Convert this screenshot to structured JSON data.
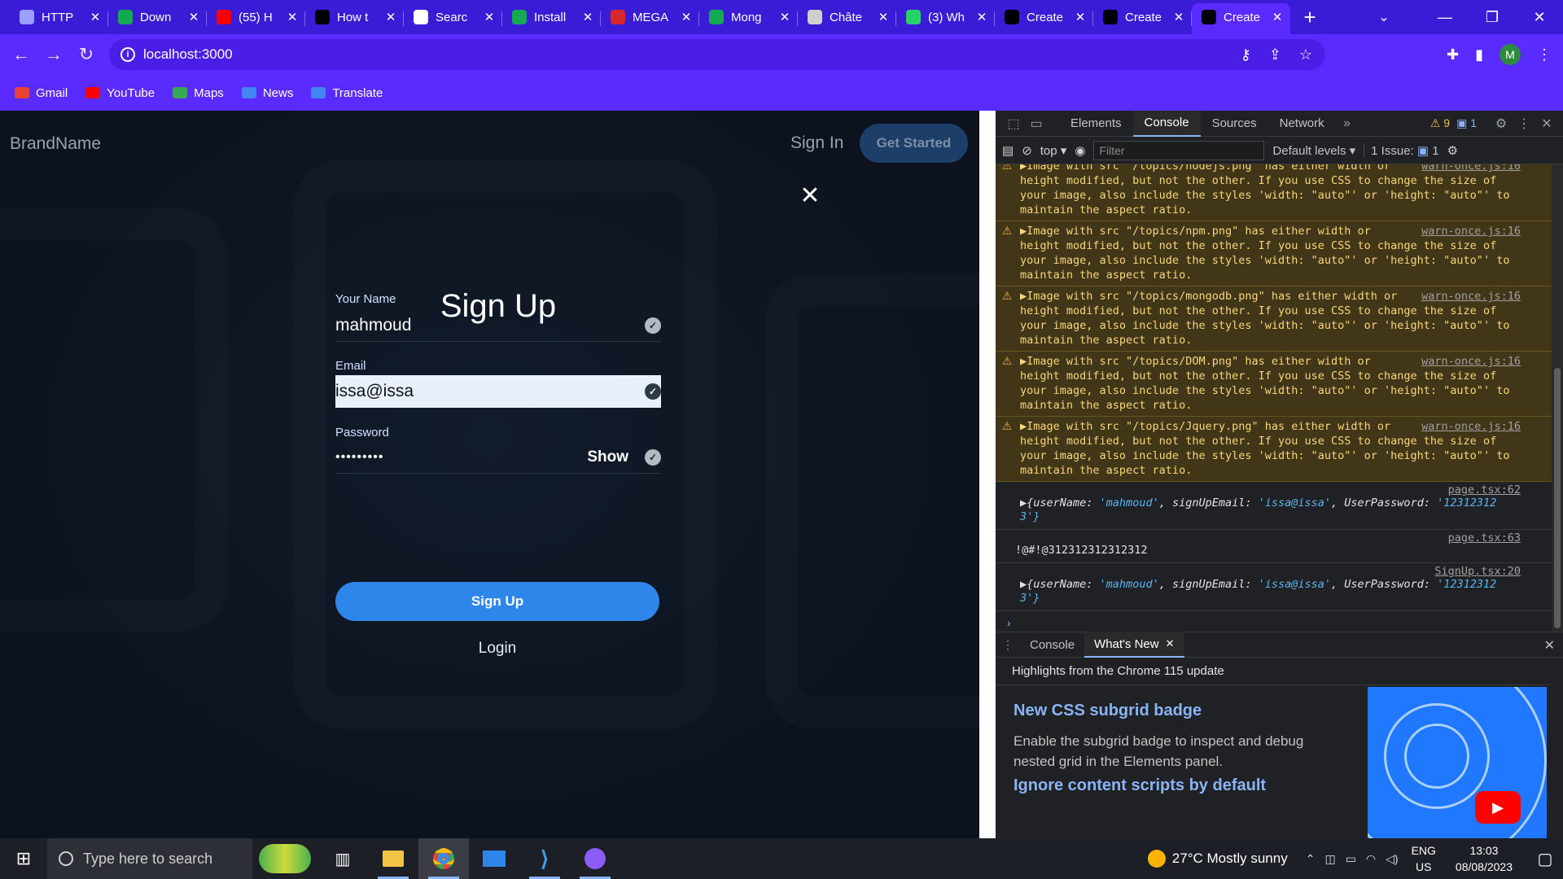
{
  "browser": {
    "tabs": [
      {
        "title": "HTTP",
        "icon": "globe-icon",
        "color": "#9aa0ff"
      },
      {
        "title": "Down",
        "icon": "mongodb-leaf-icon",
        "color": "#13aa52"
      },
      {
        "title": "(55) H",
        "icon": "youtube-icon",
        "color": "#ff0000"
      },
      {
        "title": "How t",
        "icon": "medium-icon",
        "color": "#000000"
      },
      {
        "title": "Searc",
        "icon": "search-doc-icon",
        "color": "#ffffff"
      },
      {
        "title": "Install",
        "icon": "mongodb-leaf-icon",
        "color": "#13aa52"
      },
      {
        "title": "MEGA",
        "icon": "mega-icon",
        "color": "#d9272e"
      },
      {
        "title": "Mong",
        "icon": "mongodb-leaf-icon",
        "color": "#13aa52"
      },
      {
        "title": "Châte",
        "icon": "globe-icon",
        "color": "#cfcfcf"
      },
      {
        "title": "(3) Wh",
        "icon": "whatsapp-icon",
        "color": "#25d366"
      },
      {
        "title": "Create",
        "icon": "vercel-icon",
        "color": "#000000"
      },
      {
        "title": "Create",
        "icon": "vercel-icon",
        "color": "#000000"
      },
      {
        "title": "Create",
        "icon": "vercel-icon",
        "color": "#000000",
        "active": true
      }
    ],
    "url": "localhost:3000",
    "profile_initial": "M",
    "bookmarks": [
      {
        "label": "Gmail",
        "icon": "gmail-icon",
        "color": "#ea4335"
      },
      {
        "label": "YouTube",
        "icon": "youtube-icon",
        "color": "#ff0000"
      },
      {
        "label": "Maps",
        "icon": "maps-icon",
        "color": "#34a853"
      },
      {
        "label": "News",
        "icon": "news-icon",
        "color": "#4285f4"
      },
      {
        "label": "Translate",
        "icon": "translate-icon",
        "color": "#4285f4"
      }
    ]
  },
  "site": {
    "brand": "BrandName",
    "nav_signin": "Sign In",
    "nav_get_started": "Get Started",
    "form": {
      "title": "Sign Up",
      "name_label": "Your Name",
      "name_value": "mahmoud",
      "email_label": "Email",
      "email_value": "issa@issa",
      "password_label": "Password",
      "password_value": "•••••••••",
      "show_label": "Show",
      "submit_label": "Sign Up",
      "login_label": "Login"
    }
  },
  "devtools": {
    "tabs": [
      "Elements",
      "Console",
      "Sources",
      "Network"
    ],
    "active_tab": "Console",
    "warnings_count": "9",
    "messages_count": "1",
    "context": "top",
    "filter_placeholder": "Filter",
    "levels": "Default levels",
    "issues": "1 Issue:",
    "issues_count": "1",
    "warnings": [
      {
        "text": "▶Image with src \"/topics/nodejs.png\" has either width or\nheight modified, but not the other. If you use CSS to change the size of\nyour image, also include the styles 'width: \"auto\"' or 'height: \"auto\"' to\nmaintain the aspect ratio.",
        "src": "warn-once.js:16"
      },
      {
        "text": "▶Image with src \"/topics/npm.png\" has either width or\nheight modified, but not the other. If you use CSS to change the size of\nyour image, also include the styles 'width: \"auto\"' or 'height: \"auto\"' to\nmaintain the aspect ratio.",
        "src": "warn-once.js:16"
      },
      {
        "text": "▶Image with src \"/topics/mongodb.png\" has either width or\nheight modified, but not the other. If you use CSS to change the size of\nyour image, also include the styles 'width: \"auto\"' or 'height: \"auto\"' to\nmaintain the aspect ratio.",
        "src": "warn-once.js:16"
      },
      {
        "text": "▶Image with src \"/topics/DOM.png\" has either width or\nheight modified, but not the other. If you use CSS to change the size of\nyour image, also include the styles 'width: \"auto\"' or 'height: \"auto\"' to\nmaintain the aspect ratio.",
        "src": "warn-once.js:16"
      },
      {
        "text": "▶Image with src \"/topics/Jquery.png\" has either width or\nheight modified, but not the other. If you use CSS to change the size of\nyour image, also include the styles 'width: \"auto\"' or 'height: \"auto\"' to\nmaintain the aspect ratio.",
        "src": "warn-once.js:16"
      }
    ],
    "logs": [
      {
        "src": "page.tsx:62",
        "prefix": "▶{userName: ",
        "name": "'mahmoud'",
        "mid1": ", signUpEmail: ",
        "email": "'issa@issa'",
        "mid2": ", UserPassword: ",
        "password": "'12312312",
        "tail": "3'}"
      },
      {
        "src": "page.tsx:63",
        "text": "!@#!@312312312312312"
      },
      {
        "src": "SignUp.tsx:20",
        "prefix": "▶{userName: ",
        "name": "'mahmoud'",
        "mid1": ", signUpEmail: ",
        "email": "'issa@issa'",
        "mid2": ", UserPassword: ",
        "password": "'12312312",
        "tail": "3'}"
      }
    ],
    "drawer_tabs": [
      "Console",
      "What's New"
    ],
    "whats_new": {
      "header": "Highlights from the Chrome 115 update",
      "item1_title": "New CSS subgrid badge",
      "item1_desc": "Enable the subgrid badge to inspect and debug nested grid in the Elements panel.",
      "item2_title": "Ignore content scripts by default"
    }
  },
  "taskbar": {
    "search_placeholder": "Type here to search",
    "weather": "27°C  Mostly sunny",
    "lang_top": "ENG",
    "lang_bottom": "US",
    "time": "13:03",
    "date": "08/08/2023"
  }
}
